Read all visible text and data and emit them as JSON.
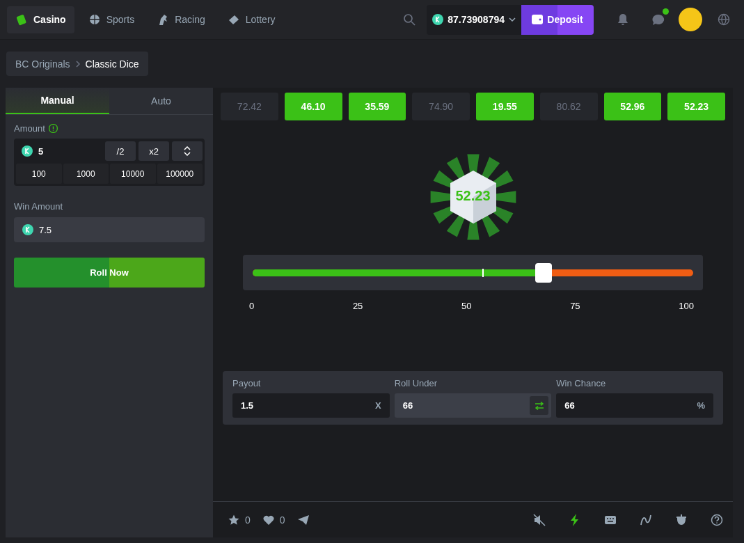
{
  "nav": {
    "items": [
      {
        "label": "Casino",
        "selected": true
      },
      {
        "label": "Sports",
        "selected": false
      },
      {
        "label": "Racing",
        "selected": false
      },
      {
        "label": "Lottery",
        "selected": false
      }
    ],
    "balance": "87.73908794",
    "deposit": "Deposit",
    "chat_unread": true
  },
  "breadcrumb": [
    "BC Originals",
    "Classic Dice"
  ],
  "bet_panel": {
    "tabs": [
      {
        "label": "Manual",
        "selected": true
      },
      {
        "label": "Auto",
        "selected": false
      }
    ],
    "amount_label": "Amount",
    "amount": "5",
    "half": "/2",
    "double": "x2",
    "presets": [
      "100",
      "1000",
      "10000",
      "100000"
    ],
    "win_label": "Win Amount",
    "win_amount": "7.5",
    "roll_button": "Roll Now"
  },
  "history": [
    {
      "value": "72.42",
      "win": false
    },
    {
      "value": "46.10",
      "win": true
    },
    {
      "value": "35.59",
      "win": true
    },
    {
      "value": "74.90",
      "win": false
    },
    {
      "value": "19.55",
      "win": true
    },
    {
      "value": "80.62",
      "win": false
    },
    {
      "value": "52.96",
      "win": true
    },
    {
      "value": "52.23",
      "win": true
    }
  ],
  "dice": {
    "result": "52.23",
    "win": true
  },
  "slider": {
    "level": 0.66,
    "result_marker": {
      "level": 0.5223
    },
    "ticks": [
      "0",
      "25",
      "50",
      "75",
      "100"
    ]
  },
  "stats": [
    {
      "label": "Payout",
      "value": "1.5",
      "suffix": "X",
      "kind": "suffix"
    },
    {
      "label": "Roll Under",
      "value": "66",
      "kind": "swap"
    },
    {
      "label": "Win Chance",
      "value": "66",
      "suffix": "%",
      "kind": "suffix"
    }
  ],
  "footer": {
    "stars_count": "0",
    "likes_count": "0",
    "tools": [
      {
        "on": false
      },
      {
        "on": true
      },
      {
        "on": false
      },
      {
        "on": false
      },
      {
        "on": false
      },
      {
        "on": false
      }
    ]
  }
}
